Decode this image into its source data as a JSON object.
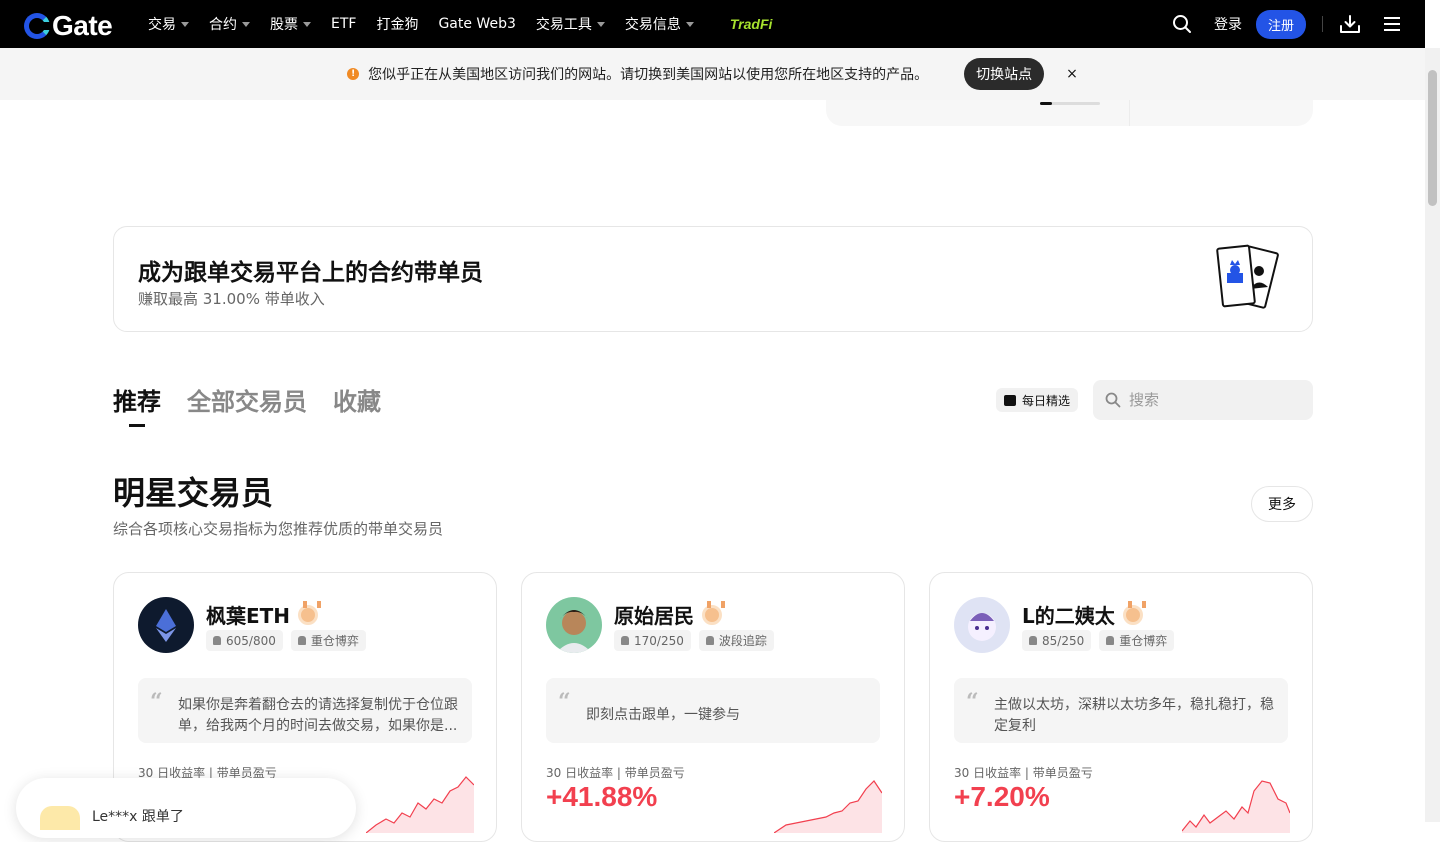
{
  "nav": {
    "logo": "Gate",
    "items": [
      {
        "label": "交易",
        "caret": true
      },
      {
        "label": "合约",
        "caret": true
      },
      {
        "label": "股票",
        "caret": true
      },
      {
        "label": "ETF",
        "caret": false
      },
      {
        "label": "打金狗",
        "caret": false
      },
      {
        "label": "Gate Web3",
        "caret": false
      },
      {
        "label": "交易工具",
        "caret": true
      },
      {
        "label": "交易信息",
        "caret": true
      }
    ],
    "tradfi": "TradFi",
    "login": "登录",
    "register": "注册"
  },
  "banner": {
    "text": "您似乎正在从美国地区访问我们的网站。请切换到美国网站以使用您所在地区支持的产品。",
    "switch": "切换站点",
    "close": "×"
  },
  "promo": {
    "title": "成为跟单交易平台上的合约带单员",
    "subtitle": "赚取最高 31.00% 带单收入"
  },
  "tabs": [
    "推荐",
    "全部交易员",
    "收藏"
  ],
  "daily_pick": "每日精选",
  "search": {
    "placeholder": "搜索"
  },
  "section": {
    "title": "明星交易员",
    "subtitle": "综合各项核心交易指标为您推荐优质的带单交易员",
    "more": "更多"
  },
  "traders": [
    {
      "name": "枫葉ETH",
      "followers": "605/800",
      "style": "重仓博弈",
      "quote": "如果你是奔着翻仓去的请选择复制优于仓位跟单，给我两个月的时间去做交易，如果你是...",
      "metric_label": "30 日收益率 | 带单员盈亏",
      "roi": "",
      "avatar_color": "#0e1a2e"
    },
    {
      "name": "原始居民",
      "followers": "170/250",
      "style": "波段追踪",
      "quote": "即刻点击跟单，一键参与",
      "metric_label": "30 日收益率 | 带单员盈亏",
      "roi": "+41.88%",
      "avatar_color": "#7ec7a0"
    },
    {
      "name": "L的二姨太",
      "followers": "85/250",
      "style": "重仓博弈",
      "quote": "主做以太坊，深耕以太坊多年，稳扎稳打，稳定复利",
      "metric_label": "30 日收益率 | 带单员盈亏",
      "roi": "+7.20%",
      "avatar_color": "#dfe3f4"
    }
  ],
  "toast": {
    "text": "Le***x 跟单了"
  },
  "colors": {
    "accent": "#2354e6",
    "profit": "#f2404f",
    "tradfi": "#a7e22e"
  }
}
